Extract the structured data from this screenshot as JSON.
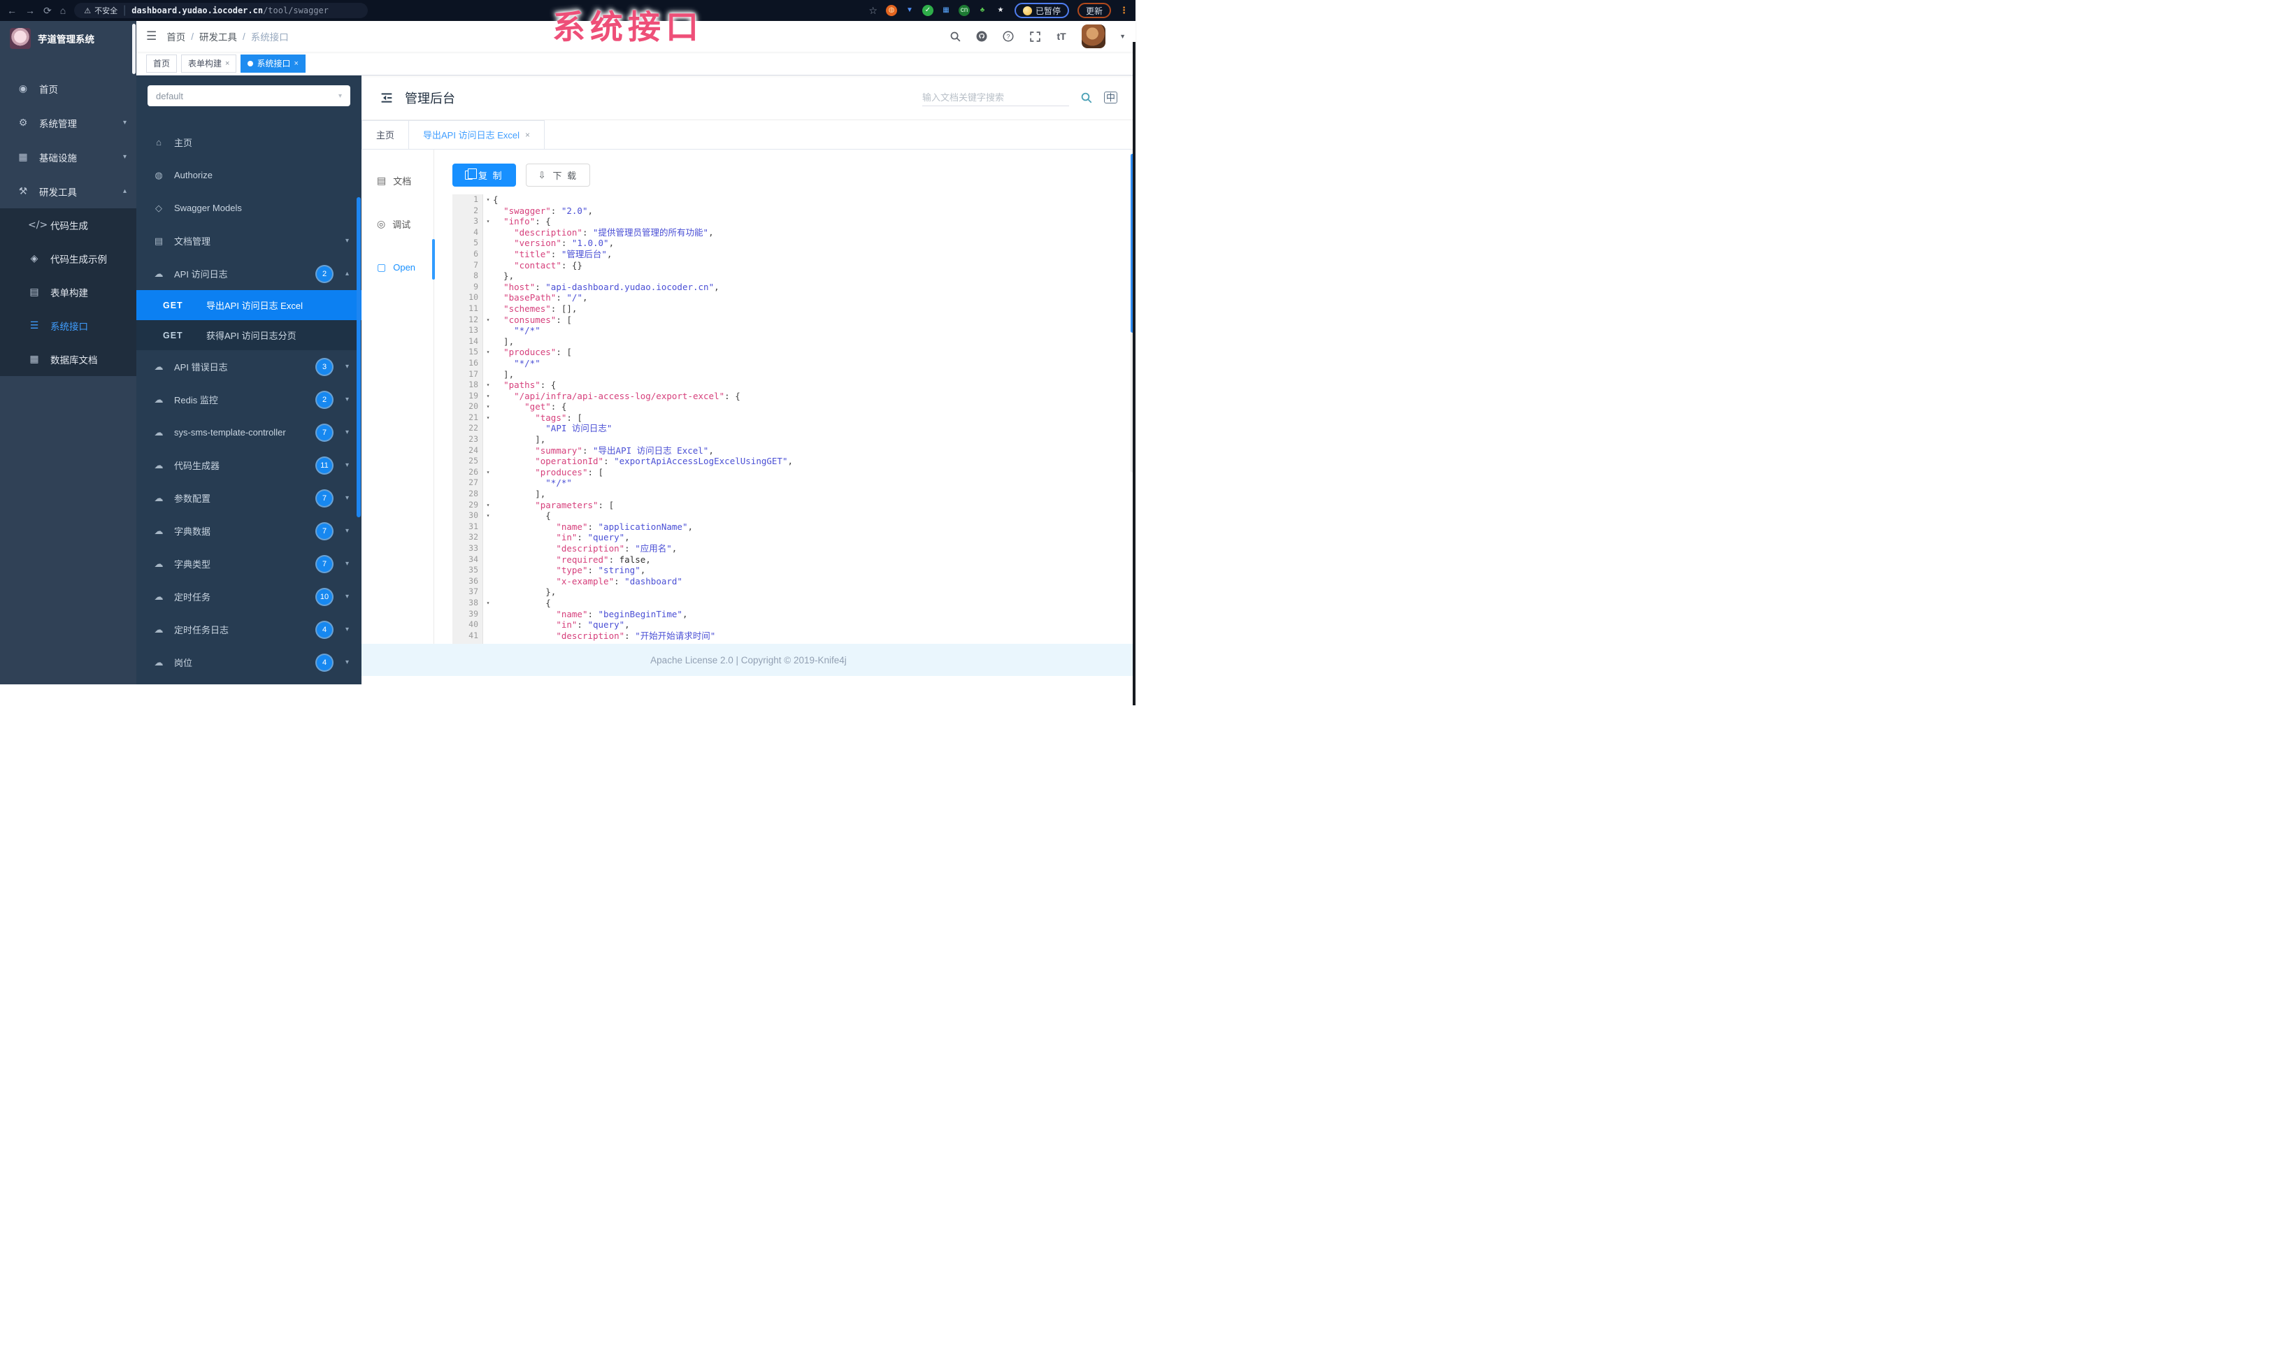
{
  "annotation": {
    "text": "系统接口",
    "color": "#ee4f78"
  },
  "icons": {
    "back": "←",
    "forward": "→",
    "reload": "⟳",
    "home": "⌂",
    "warning": "⚠",
    "bookmark": "☆",
    "hamburger": "☰",
    "caret_down": "▼",
    "kebab": "⋮",
    "chev_down": "▾",
    "chev_up": "▴",
    "fold": "▾",
    "download": "⇩",
    "dashboard-icon": "◉",
    "gear-icon": "⚙",
    "infra-icon": "▦",
    "tools-icon": "⚒",
    "code-icon": "</>",
    "shield-icon": "◈",
    "form-icon": "▤",
    "api-icon": "☰",
    "db-icon": "▦",
    "home-icon": "⌂",
    "lock-icon": "◍",
    "models-icon": "◇",
    "docs-icon": "▤",
    "cloud-icon": "☁",
    "doc-icon": "▤",
    "debug-icon": "◎",
    "open-icon": "▢"
  },
  "browser": {
    "security_label": "不安全",
    "url_host": "dashboard.yudao.iocoder.cn",
    "url_path": "/tool/swagger",
    "paused_label": "已暂停",
    "update_label": "更新",
    "extensions": [
      {
        "name": "ext-orange",
        "glyph": "◍",
        "fg": "#ffd9a8",
        "bg": "#e2641f"
      },
      {
        "name": "ext-pin",
        "glyph": "▼",
        "fg": "#4f8ef5",
        "bg": "transparent"
      },
      {
        "name": "ext-green-check",
        "glyph": "✓",
        "fg": "#fff",
        "bg": "#2fae4a"
      },
      {
        "name": "ext-grid",
        "glyph": "▦",
        "fg": "#58a6ff",
        "bg": "transparent"
      },
      {
        "name": "ext-cn",
        "glyph": "cn",
        "fg": "#d9ffe0",
        "bg": "#1d7a33"
      },
      {
        "name": "ext-leaf",
        "glyph": "♣",
        "fg": "#57c24f",
        "bg": "transparent"
      },
      {
        "name": "ext-star",
        "glyph": "★",
        "fg": "#f2f4f8",
        "bg": "transparent"
      }
    ]
  },
  "sidebar": {
    "logo_title": "芋道管理系统",
    "items": [
      {
        "label": "首页",
        "icon": "dashboard-icon",
        "chevron": ""
      },
      {
        "label": "系统管理",
        "icon": "gear-icon",
        "chevron": "down"
      },
      {
        "label": "基础设施",
        "icon": "infra-icon",
        "chevron": "down"
      },
      {
        "label": "研发工具",
        "icon": "tools-icon",
        "chevron": "up",
        "children": [
          {
            "label": "代码生成",
            "icon": "code-icon",
            "active": false
          },
          {
            "label": "代码生成示例",
            "icon": "shield-icon",
            "active": false
          },
          {
            "label": "表单构建",
            "icon": "form-icon",
            "active": false
          },
          {
            "label": "系统接口",
            "icon": "api-icon",
            "active": true
          },
          {
            "label": "数据库文档",
            "icon": "db-icon",
            "active": false
          }
        ]
      }
    ]
  },
  "navbar": {
    "breadcrumb": [
      "首页",
      "研发工具",
      "系统接口"
    ],
    "tags": [
      {
        "label": "首页",
        "closable": false,
        "active": false
      },
      {
        "label": "表单构建",
        "closable": true,
        "active": false
      },
      {
        "label": "系统接口",
        "closable": true,
        "active": true
      }
    ]
  },
  "api_sidebar": {
    "group_select_value": "default",
    "items": [
      {
        "label": "主页",
        "icon": "home-icon",
        "badge": "",
        "chevron": ""
      },
      {
        "label": "Authorize",
        "icon": "lock-icon",
        "badge": "",
        "chevron": ""
      },
      {
        "label": "Swagger Models",
        "icon": "models-icon",
        "badge": "",
        "chevron": ""
      },
      {
        "label": "文档管理",
        "icon": "docs-icon",
        "badge": "",
        "chevron": "down"
      },
      {
        "label": "API 访问日志",
        "icon": "cloud-icon",
        "badge": "2",
        "chevron": "up"
      }
    ],
    "operations": [
      {
        "method": "GET",
        "label": "导出API 访问日志 Excel",
        "active": true
      },
      {
        "method": "GET",
        "label": "获得API 访问日志分页",
        "active": false
      }
    ],
    "groups": [
      {
        "label": "API 错误日志",
        "icon": "cloud-icon",
        "badge": "3"
      },
      {
        "label": "Redis 监控",
        "icon": "cloud-icon",
        "badge": "2"
      },
      {
        "label": "sys-sms-template-controller",
        "icon": "cloud-icon",
        "badge": "7"
      },
      {
        "label": "代码生成器",
        "icon": "cloud-icon",
        "badge": "11"
      },
      {
        "label": "参数配置",
        "icon": "cloud-icon",
        "badge": "7"
      },
      {
        "label": "字典数据",
        "icon": "cloud-icon",
        "badge": "7"
      },
      {
        "label": "字典类型",
        "icon": "cloud-icon",
        "badge": "7"
      },
      {
        "label": "定时任务",
        "icon": "cloud-icon",
        "badge": "10"
      },
      {
        "label": "定时任务日志",
        "icon": "cloud-icon",
        "badge": "4"
      },
      {
        "label": "岗位",
        "icon": "cloud-icon",
        "badge": "4"
      }
    ]
  },
  "doc": {
    "title": "管理后台",
    "search_placeholder": "输入文档关键字搜索",
    "lang_label": "中",
    "tabs": [
      {
        "label": "主页",
        "closable": false,
        "active": false
      },
      {
        "label": "导出API 访问日志 Excel",
        "closable": true,
        "active": true
      }
    ],
    "side_tabs": [
      {
        "label": "文档",
        "icon": "doc-icon",
        "active": false
      },
      {
        "label": "调试",
        "icon": "debug-icon",
        "active": false
      },
      {
        "label": "Open",
        "icon": "open-icon",
        "active": true
      }
    ],
    "copy_label": "复 制",
    "download_label": "下 载",
    "footer": "Apache License 2.0 | Copyright © 2019-Knife4j"
  },
  "editor": {
    "lines": [
      {
        "n": 1,
        "fold": true,
        "t": [
          [
            "p",
            "{"
          ]
        ]
      },
      {
        "n": 2,
        "fold": false,
        "t": [
          [
            "p",
            "  "
          ],
          [
            "k",
            "\"swagger\""
          ],
          [
            "p",
            ": "
          ],
          [
            "s",
            "\"2.0\""
          ],
          [
            "p",
            ","
          ]
        ]
      },
      {
        "n": 3,
        "fold": true,
        "t": [
          [
            "p",
            "  "
          ],
          [
            "k",
            "\"info\""
          ],
          [
            "p",
            ": {"
          ]
        ]
      },
      {
        "n": 4,
        "fold": false,
        "t": [
          [
            "p",
            "    "
          ],
          [
            "k",
            "\"description\""
          ],
          [
            "p",
            ": "
          ],
          [
            "s",
            "\"提供管理员管理的所有功能\""
          ],
          [
            "p",
            ","
          ]
        ]
      },
      {
        "n": 5,
        "fold": false,
        "t": [
          [
            "p",
            "    "
          ],
          [
            "k",
            "\"version\""
          ],
          [
            "p",
            ": "
          ],
          [
            "s",
            "\"1.0.0\""
          ],
          [
            "p",
            ","
          ]
        ]
      },
      {
        "n": 6,
        "fold": false,
        "t": [
          [
            "p",
            "    "
          ],
          [
            "k",
            "\"title\""
          ],
          [
            "p",
            ": "
          ],
          [
            "s",
            "\"管理后台\""
          ],
          [
            "p",
            ","
          ]
        ]
      },
      {
        "n": 7,
        "fold": false,
        "t": [
          [
            "p",
            "    "
          ],
          [
            "k",
            "\"contact\""
          ],
          [
            "p",
            ": {}"
          ]
        ]
      },
      {
        "n": 8,
        "fold": false,
        "t": [
          [
            "p",
            "  },"
          ]
        ]
      },
      {
        "n": 9,
        "fold": false,
        "t": [
          [
            "p",
            "  "
          ],
          [
            "k",
            "\"host\""
          ],
          [
            "p",
            ": "
          ],
          [
            "s",
            "\"api-dashboard.yudao.iocoder.cn\""
          ],
          [
            "p",
            ","
          ]
        ]
      },
      {
        "n": 10,
        "fold": false,
        "t": [
          [
            "p",
            "  "
          ],
          [
            "k",
            "\"basePath\""
          ],
          [
            "p",
            ": "
          ],
          [
            "s",
            "\"/\""
          ],
          [
            "p",
            ","
          ]
        ]
      },
      {
        "n": 11,
        "fold": false,
        "t": [
          [
            "p",
            "  "
          ],
          [
            "k",
            "\"schemes\""
          ],
          [
            "p",
            ": [],"
          ]
        ]
      },
      {
        "n": 12,
        "fold": true,
        "t": [
          [
            "p",
            "  "
          ],
          [
            "k",
            "\"consumes\""
          ],
          [
            "p",
            ": ["
          ]
        ]
      },
      {
        "n": 13,
        "fold": false,
        "t": [
          [
            "p",
            "    "
          ],
          [
            "s",
            "\"*/*\""
          ]
        ]
      },
      {
        "n": 14,
        "fold": false,
        "t": [
          [
            "p",
            "  ],"
          ]
        ]
      },
      {
        "n": 15,
        "fold": true,
        "t": [
          [
            "p",
            "  "
          ],
          [
            "k",
            "\"produces\""
          ],
          [
            "p",
            ": ["
          ]
        ]
      },
      {
        "n": 16,
        "fold": false,
        "t": [
          [
            "p",
            "    "
          ],
          [
            "s",
            "\"*/*\""
          ]
        ]
      },
      {
        "n": 17,
        "fold": false,
        "t": [
          [
            "p",
            "  ],"
          ]
        ]
      },
      {
        "n": 18,
        "fold": true,
        "t": [
          [
            "p",
            "  "
          ],
          [
            "k",
            "\"paths\""
          ],
          [
            "p",
            ": {"
          ]
        ]
      },
      {
        "n": 19,
        "fold": true,
        "t": [
          [
            "p",
            "    "
          ],
          [
            "k",
            "\"/api/infra/api-access-log/export-excel\""
          ],
          [
            "p",
            ": {"
          ]
        ]
      },
      {
        "n": 20,
        "fold": true,
        "t": [
          [
            "p",
            "      "
          ],
          [
            "k",
            "\"get\""
          ],
          [
            "p",
            ": {"
          ]
        ]
      },
      {
        "n": 21,
        "fold": true,
        "t": [
          [
            "p",
            "        "
          ],
          [
            "k",
            "\"tags\""
          ],
          [
            "p",
            ": ["
          ]
        ]
      },
      {
        "n": 22,
        "fold": false,
        "t": [
          [
            "p",
            "          "
          ],
          [
            "s",
            "\"API 访问日志\""
          ]
        ]
      },
      {
        "n": 23,
        "fold": false,
        "t": [
          [
            "p",
            "        ],"
          ]
        ]
      },
      {
        "n": 24,
        "fold": false,
        "t": [
          [
            "p",
            "        "
          ],
          [
            "k",
            "\"summary\""
          ],
          [
            "p",
            ": "
          ],
          [
            "s",
            "\"导出API 访问日志 Excel\""
          ],
          [
            "p",
            ","
          ]
        ]
      },
      {
        "n": 25,
        "fold": false,
        "t": [
          [
            "p",
            "        "
          ],
          [
            "k",
            "\"operationId\""
          ],
          [
            "p",
            ": "
          ],
          [
            "s",
            "\"exportApiAccessLogExcelUsingGET\""
          ],
          [
            "p",
            ","
          ]
        ]
      },
      {
        "n": 26,
        "fold": true,
        "t": [
          [
            "p",
            "        "
          ],
          [
            "k",
            "\"produces\""
          ],
          [
            "p",
            ": ["
          ]
        ]
      },
      {
        "n": 27,
        "fold": false,
        "t": [
          [
            "p",
            "          "
          ],
          [
            "s",
            "\"*/*\""
          ]
        ]
      },
      {
        "n": 28,
        "fold": false,
        "t": [
          [
            "p",
            "        ],"
          ]
        ]
      },
      {
        "n": 29,
        "fold": true,
        "t": [
          [
            "p",
            "        "
          ],
          [
            "k",
            "\"parameters\""
          ],
          [
            "p",
            ": ["
          ]
        ]
      },
      {
        "n": 30,
        "fold": true,
        "t": [
          [
            "p",
            "          {"
          ]
        ]
      },
      {
        "n": 31,
        "fold": false,
        "t": [
          [
            "p",
            "            "
          ],
          [
            "k",
            "\"name\""
          ],
          [
            "p",
            ": "
          ],
          [
            "s",
            "\"applicationName\""
          ],
          [
            "p",
            ","
          ]
        ]
      },
      {
        "n": 32,
        "fold": false,
        "t": [
          [
            "p",
            "            "
          ],
          [
            "k",
            "\"in\""
          ],
          [
            "p",
            ": "
          ],
          [
            "s",
            "\"query\""
          ],
          [
            "p",
            ","
          ]
        ]
      },
      {
        "n": 33,
        "fold": false,
        "t": [
          [
            "p",
            "            "
          ],
          [
            "k",
            "\"description\""
          ],
          [
            "p",
            ": "
          ],
          [
            "s",
            "\"应用名\""
          ],
          [
            "p",
            ","
          ]
        ]
      },
      {
        "n": 34,
        "fold": false,
        "t": [
          [
            "p",
            "            "
          ],
          [
            "k",
            "\"required\""
          ],
          [
            "p",
            ": "
          ],
          [
            "b",
            "false"
          ],
          [
            "p",
            ","
          ]
        ]
      },
      {
        "n": 35,
        "fold": false,
        "t": [
          [
            "p",
            "            "
          ],
          [
            "k",
            "\"type\""
          ],
          [
            "p",
            ": "
          ],
          [
            "s",
            "\"string\""
          ],
          [
            "p",
            ","
          ]
        ]
      },
      {
        "n": 36,
        "fold": false,
        "t": [
          [
            "p",
            "            "
          ],
          [
            "k",
            "\"x-example\""
          ],
          [
            "p",
            ": "
          ],
          [
            "s",
            "\"dashboard\""
          ]
        ]
      },
      {
        "n": 37,
        "fold": false,
        "t": [
          [
            "p",
            "          },"
          ]
        ]
      },
      {
        "n": 38,
        "fold": true,
        "t": [
          [
            "p",
            "          {"
          ]
        ]
      },
      {
        "n": 39,
        "fold": false,
        "t": [
          [
            "p",
            "            "
          ],
          [
            "k",
            "\"name\""
          ],
          [
            "p",
            ": "
          ],
          [
            "s",
            "\"beginBeginTime\""
          ],
          [
            "p",
            ","
          ]
        ]
      },
      {
        "n": 40,
        "fold": false,
        "t": [
          [
            "p",
            "            "
          ],
          [
            "k",
            "\"in\""
          ],
          [
            "p",
            ": "
          ],
          [
            "s",
            "\"query\""
          ],
          [
            "p",
            ","
          ]
        ]
      },
      {
        "n": 41,
        "fold": false,
        "t": [
          [
            "p",
            "            "
          ],
          [
            "k",
            "\"description\""
          ],
          [
            "p",
            ": "
          ],
          [
            "s",
            "\"开始开始请求时间\""
          ]
        ]
      }
    ]
  }
}
